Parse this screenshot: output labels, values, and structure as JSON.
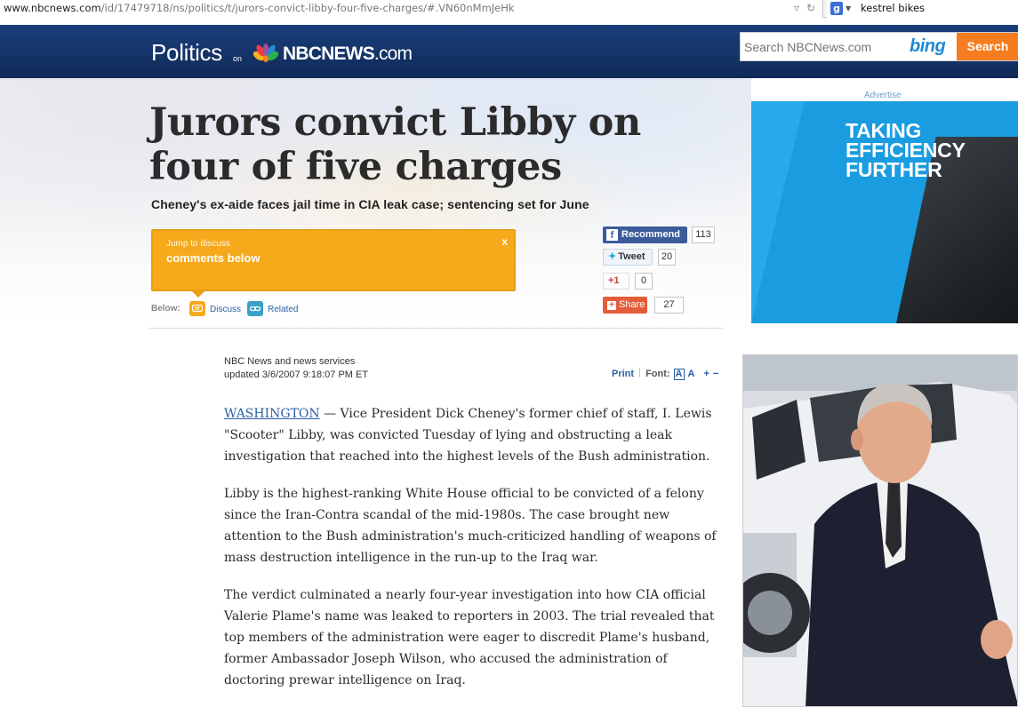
{
  "browser": {
    "url_host": "www.nbcnews.com",
    "url_path": "/id/17479718/ns/politics/t/jurors-convict-libby-four-five-charges/#.VN60nMmJeHk",
    "search_engine_icon": "g",
    "search_query": "kestrel bikes"
  },
  "header": {
    "section": "Politics",
    "on": "on",
    "brand": "NBCNEWS",
    "brand_suffix": ".com",
    "search_placeholder": "Search NBCNews.com",
    "search_provider": "bing",
    "search_button": "Search",
    "colors": {
      "header_bg": "#14346a",
      "search_button": "#f57c1f",
      "bing": "#1e88d6"
    }
  },
  "article": {
    "headline": "Jurors convict Libby on four of five charges",
    "subhead": "Cheney's ex-aide faces jail time in CIA leak case; sentencing set for June",
    "source": "NBC News and news services",
    "updated": "updated 3/6/2007 9:18:07 PM ET",
    "dateline": "WASHINGTON",
    "lead_rest": " — Vice President Dick Cheney's former chief of staff, I. Lewis \"Scooter\" Libby, was convicted Tuesday of lying and obstructing a leak investigation that reached into the highest levels of the Bush administration.",
    "paragraph_2": "Libby is the highest-ranking White House official to be convicted of a felony since the Iran-Contra scandal of the mid-1980s. The case brought new attention to the Bush administration's much-criticized handling of weapons of mass destruction intelligence in the run-up to the Iraq war.",
    "paragraph_3": "The verdict culminated a nearly four-year investigation into how CIA official Valerie Plame's name was leaked to reporters in 2003. The trial revealed that top members of the administration were eager to discredit Plame's husband, former Ambassador Joseph Wilson, who accused the administration of doctoring prewar intelligence on Iraq."
  },
  "discuss_box": {
    "small": "Jump to discuss",
    "big": "comments below",
    "close": "x"
  },
  "below": {
    "label": "Below:",
    "discuss": "Discuss",
    "related": "Related"
  },
  "social": {
    "recommend_icon": "f",
    "recommend_label": "Recommend",
    "recommend_count": "113",
    "tweet_label": "Tweet",
    "tweet_count": "20",
    "gplus_label": "+1",
    "gplus_count": "0",
    "share_icon": "+",
    "share_label": "Share",
    "share_count": "27"
  },
  "tools": {
    "print": "Print",
    "font_label": "Font:",
    "font_a_boxed": "A",
    "font_a": "A",
    "font_increase": "+",
    "font_decrease": "−"
  },
  "ad": {
    "label": "Advertise",
    "line1": "TAKING",
    "line2": "EFFICIENCY",
    "line3": "FURTHER"
  },
  "icons": [
    "peacock-logo-icon",
    "speech-bubble-icon",
    "link-icon",
    "facebook-icon",
    "twitter-bird-icon",
    "google-plus-icon",
    "share-icon",
    "dropdown-arrow-icon",
    "reload-icon"
  ]
}
